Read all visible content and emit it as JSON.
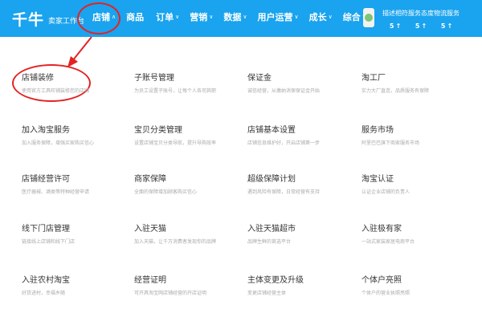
{
  "logo": {
    "big": "千牛",
    "sub": "卖家工作台"
  },
  "nav": [
    {
      "label": "店铺",
      "chevron": "∧"
    },
    {
      "label": "商品",
      "chevron": ""
    },
    {
      "label": "订单",
      "chevron": "∨"
    },
    {
      "label": "营销",
      "chevron": "∨"
    },
    {
      "label": "数据",
      "chevron": "∨"
    },
    {
      "label": "用户运营",
      "chevron": "∨"
    },
    {
      "label": "成长",
      "chevron": "∨"
    },
    {
      "label": "综合",
      "chevron": "∨"
    }
  ],
  "stats": [
    {
      "label": "描述相符",
      "value": "5",
      "arrow": "↑"
    },
    {
      "label": "服务态度",
      "value": "5",
      "arrow": "↑"
    },
    {
      "label": "物流服务",
      "value": "5",
      "arrow": "↑"
    }
  ],
  "items": [
    {
      "title": "店铺装修",
      "desc": "使用官方工具旺铺装修您的店铺"
    },
    {
      "title": "子账号管理",
      "desc": "为员工设置子账号，让每个人各司其职"
    },
    {
      "title": "保证金",
      "desc": "诚信经营，从缴纳消保保证金开始"
    },
    {
      "title": "淘工厂",
      "desc": "实力大厂直连，品质服务有保障"
    },
    {
      "title": "加入淘宝服务",
      "desc": "加入服务保障，增强买家购买信心"
    },
    {
      "title": "宝贝分类管理",
      "desc": "设置店铺宝贝分类导航，提升导购效率"
    },
    {
      "title": "店铺基本设置",
      "desc": "店铺信息维护好，开启店铺第一步"
    },
    {
      "title": "服务市场",
      "desc": "阿里巴巴旗下商家服务市场"
    },
    {
      "title": "店铺经营许可",
      "desc": "医疗器械、酒类等特种经营申请"
    },
    {
      "title": "商家保障",
      "desc": "全面的保障增加顾客购买信心"
    },
    {
      "title": "超级保障计划",
      "desc": "遇到风险有保障，日常经营有支持"
    },
    {
      "title": "淘宝认证",
      "desc": "认证企业店铺的负责人"
    },
    {
      "title": "线下门店管理",
      "desc": "链接线上店铺和线下门店"
    },
    {
      "title": "入驻天猫",
      "desc": "加入天猫，让千万消费者发现你的品牌"
    },
    {
      "title": "入驻天猫超市",
      "desc": "品牌生鲜的首选平台"
    },
    {
      "title": "入驻极有家",
      "desc": "一站式家装家居电商平台"
    },
    {
      "title": "入驻农村淘宝",
      "desc": "好货进村，幸福乡随"
    },
    {
      "title": "经营证明",
      "desc": "可开具淘宝网店铺经营的开店证明"
    },
    {
      "title": "主体变更及升级",
      "desc": "变更店铺经营主体"
    },
    {
      "title": "个体户亮照",
      "desc": "个体户的营业执照亮照"
    }
  ],
  "colors": {
    "topbar": "#1aa3ee",
    "annotation": "#e32323"
  }
}
